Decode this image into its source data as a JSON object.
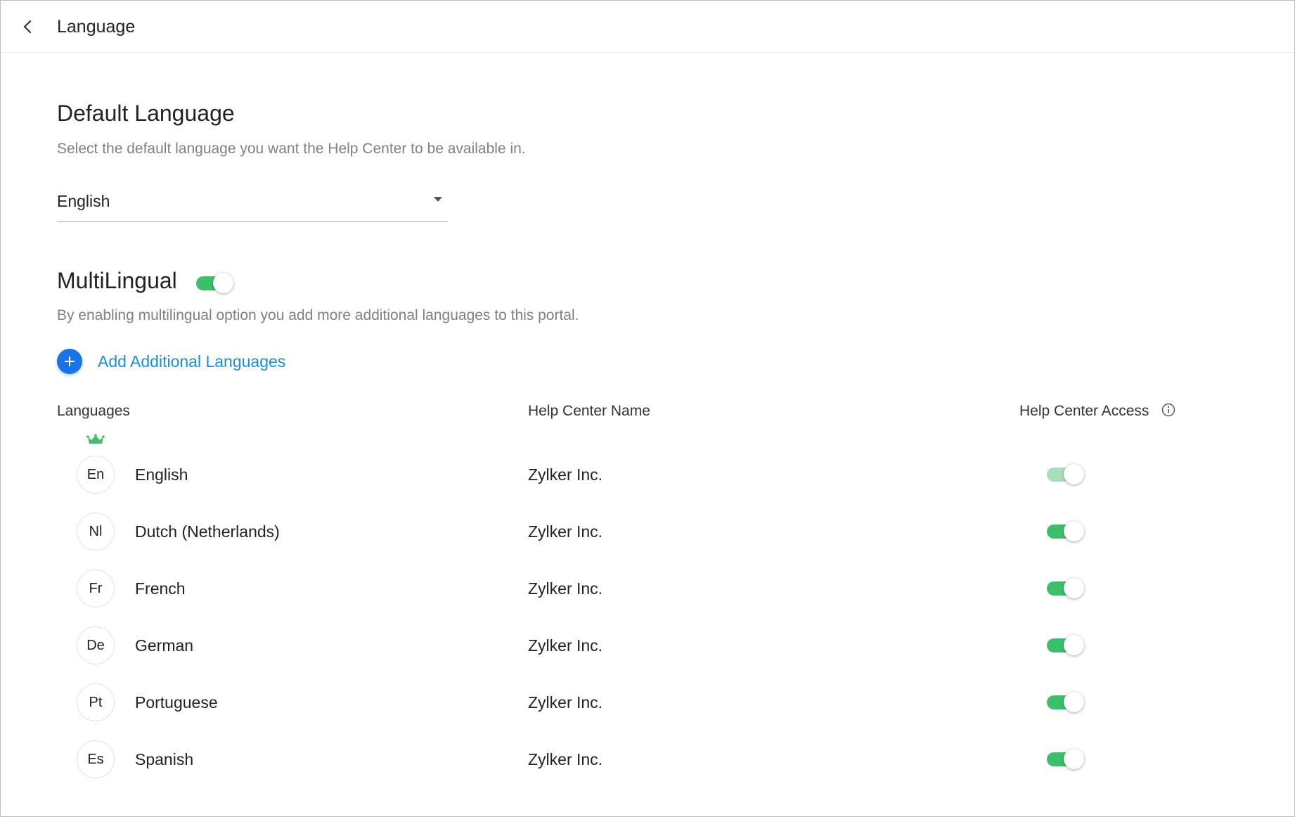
{
  "header": {
    "title": "Language"
  },
  "default_language": {
    "title": "Default Language",
    "description": "Select the default language you want the Help Center to be available in.",
    "selected": "English"
  },
  "multilingual": {
    "title": "MultiLingual",
    "enabled": true,
    "description": "By enabling multilingual option you add more additional languages to this portal.",
    "add_label": "Add Additional Languages"
  },
  "table": {
    "headers": {
      "languages": "Languages",
      "help_center_name": "Help Center Name",
      "help_center_access": "Help Center Access"
    },
    "rows": [
      {
        "code": "En",
        "language": "English",
        "help_center_name": "Zylker Inc.",
        "access": true,
        "default": true
      },
      {
        "code": "Nl",
        "language": "Dutch (Netherlands)",
        "help_center_name": "Zylker Inc.",
        "access": true,
        "default": false
      },
      {
        "code": "Fr",
        "language": "French",
        "help_center_name": "Zylker Inc.",
        "access": true,
        "default": false
      },
      {
        "code": "De",
        "language": "German",
        "help_center_name": "Zylker Inc.",
        "access": true,
        "default": false
      },
      {
        "code": "Pt",
        "language": "Portuguese",
        "help_center_name": "Zylker Inc.",
        "access": true,
        "default": false
      },
      {
        "code": "Es",
        "language": "Spanish",
        "help_center_name": "Zylker Inc.",
        "access": true,
        "default": false
      }
    ]
  },
  "icons": {
    "back": "chevron-left-icon",
    "add": "plus-icon",
    "info": "info-icon",
    "default_marker": "crown-icon"
  },
  "colors": {
    "toggle_on": "#3cbf6b",
    "toggle_disabled": "#a8dfbb",
    "accent_blue": "#1a73e8",
    "link_blue": "#1a8ed8",
    "crown_green": "#3cbf6b"
  }
}
